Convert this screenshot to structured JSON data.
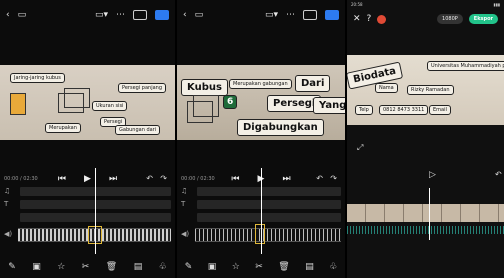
{
  "panel1": {
    "time": "00:00 / 02:30",
    "cards": [
      "Jaring-jaring kubus",
      "Persegi panjang",
      "Ukuran sisi",
      "Persegi",
      "Merupakan",
      "Gabungan dari"
    ]
  },
  "panel2": {
    "time": "00:00 / 02:30",
    "cards": [
      "Kubus",
      "Merupakan gabungan",
      "Dari",
      "6",
      "Persegi",
      "Yang",
      "Digabungkan"
    ]
  },
  "panel3": {
    "status_time": "20:58",
    "resolution": "1080P",
    "export_label": "Ekspor",
    "cards": [
      "Biodata",
      "Universitas Muhammadiyah prof Dr Hamka",
      "Nama",
      "Rizky Ramadan",
      "Telp",
      "0812 8473 3311",
      "Email"
    ]
  },
  "colors": {
    "accent": "#2d7bf0",
    "export": "#22c38a",
    "playhead": "#ffffff",
    "selection": "#e0b83a"
  }
}
